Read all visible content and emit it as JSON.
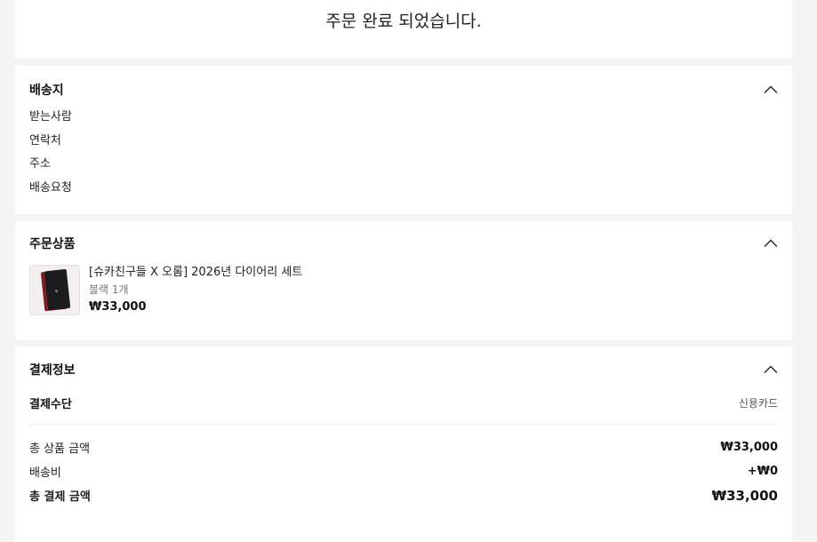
{
  "header": {
    "complete_message": "주문 완료 되었습니다."
  },
  "shipping": {
    "title": "배송지",
    "toggle_icon": "chevron-up-icon",
    "rows": [
      "받는사람",
      "연락처",
      "주소",
      "배송요청"
    ]
  },
  "products": {
    "title": "주문상품",
    "toggle_icon": "chevron-up-icon",
    "items": [
      {
        "name": "[슈카친구들 X 오롬] 2026년 다이어리 세트",
        "option": "블랙 1개",
        "price": "₩33,000",
        "thumbnail": "diary-set-image"
      }
    ]
  },
  "payment": {
    "title": "결제정보",
    "toggle_icon": "chevron-up-icon",
    "method_label": "결제수단",
    "method_value": "신용카드",
    "summary": [
      {
        "label": "총 상품 금액",
        "value": "₩33,000"
      },
      {
        "label": "배송비",
        "value": "+₩0"
      },
      {
        "label": "총 결제 금액",
        "value": "₩33,000"
      }
    ]
  },
  "colors": {
    "background": "#f4f4f4",
    "card": "#ffffff",
    "text": "#111111",
    "muted": "#777777"
  }
}
